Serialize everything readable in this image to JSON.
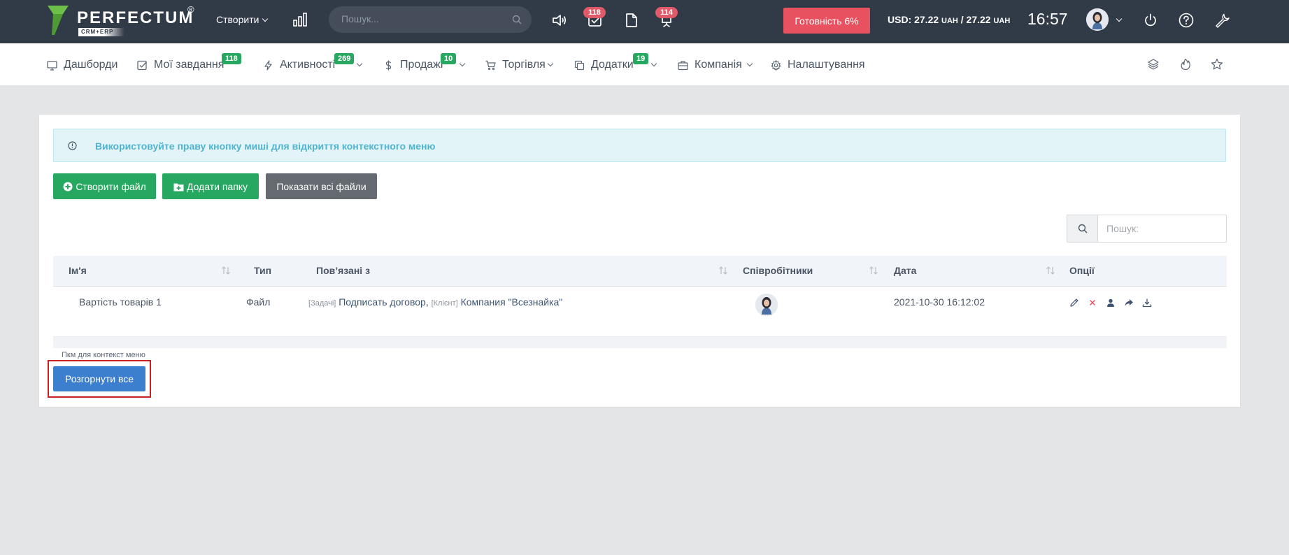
{
  "topbar": {
    "logo_text": "PERFECTUM",
    "logo_reg": "®",
    "logo_sub": "CRM+ERP",
    "create_label": "Створити",
    "search_placeholder": "Пошук...",
    "tasks_badge": "118",
    "notifications_badge": "114",
    "ready_label": "Готовність 6%",
    "currency_usd": "USD: 27.22",
    "currency_uah1": "UAH",
    "currency_sep": " / 27.22 ",
    "currency_uah2": "UAH",
    "time": "16:57"
  },
  "nav": {
    "dashboards": "Дашборди",
    "my_tasks": "Мої завдання",
    "my_tasks_badge": "118",
    "activities": "Активності",
    "activities_badge": "269",
    "sales": "Продажі",
    "sales_badge": "10",
    "trade": "Торгівля",
    "addons": "Додатки",
    "addons_badge": "19",
    "company": "Компанія",
    "settings": "Налаштування"
  },
  "alert": {
    "text": "Використовуйте праву кнопку миші для відкриття контекстного меню"
  },
  "buttons": {
    "create_file": "Створити файл",
    "add_folder": "Додати папку",
    "show_all": "Показати всі файли",
    "expand_all": "Розгорнути все"
  },
  "table_search": {
    "placeholder": "Пошук:"
  },
  "table": {
    "headers": {
      "name": "Ім'я",
      "type": "Тип",
      "related": "Пов’язані з",
      "employees": "Співробітники",
      "date": "Дата",
      "options": "Опції"
    },
    "rows": [
      {
        "name": "Вартість товарів 1",
        "type": "Файл",
        "related_tag1": "[Задачі]",
        "related_link1": "Подписать договор,",
        "related_tag2": "[Клієнт]",
        "related_link2": "Компания \"Всезнайка\"",
        "date": "2021-10-30 16:12:02"
      }
    ]
  },
  "hint": "Пкм для контекст меню",
  "colors": {
    "topbar": "#313a47",
    "green": "#27a860",
    "gray": "#646a70",
    "blue": "#3d7fcf",
    "danger": "#e8515f",
    "alert_text": "#4fb5cf",
    "highlight": "#cc1f1f"
  },
  "icons": [
    "megaphone-icon",
    "tasks-icon",
    "file-icon",
    "notifications-icon",
    "power-icon",
    "help-icon",
    "wrench-icon",
    "layers-icon",
    "fire-icon",
    "star-icon",
    "edit-icon",
    "delete-icon",
    "assign-icon",
    "share-icon",
    "download-icon"
  ]
}
